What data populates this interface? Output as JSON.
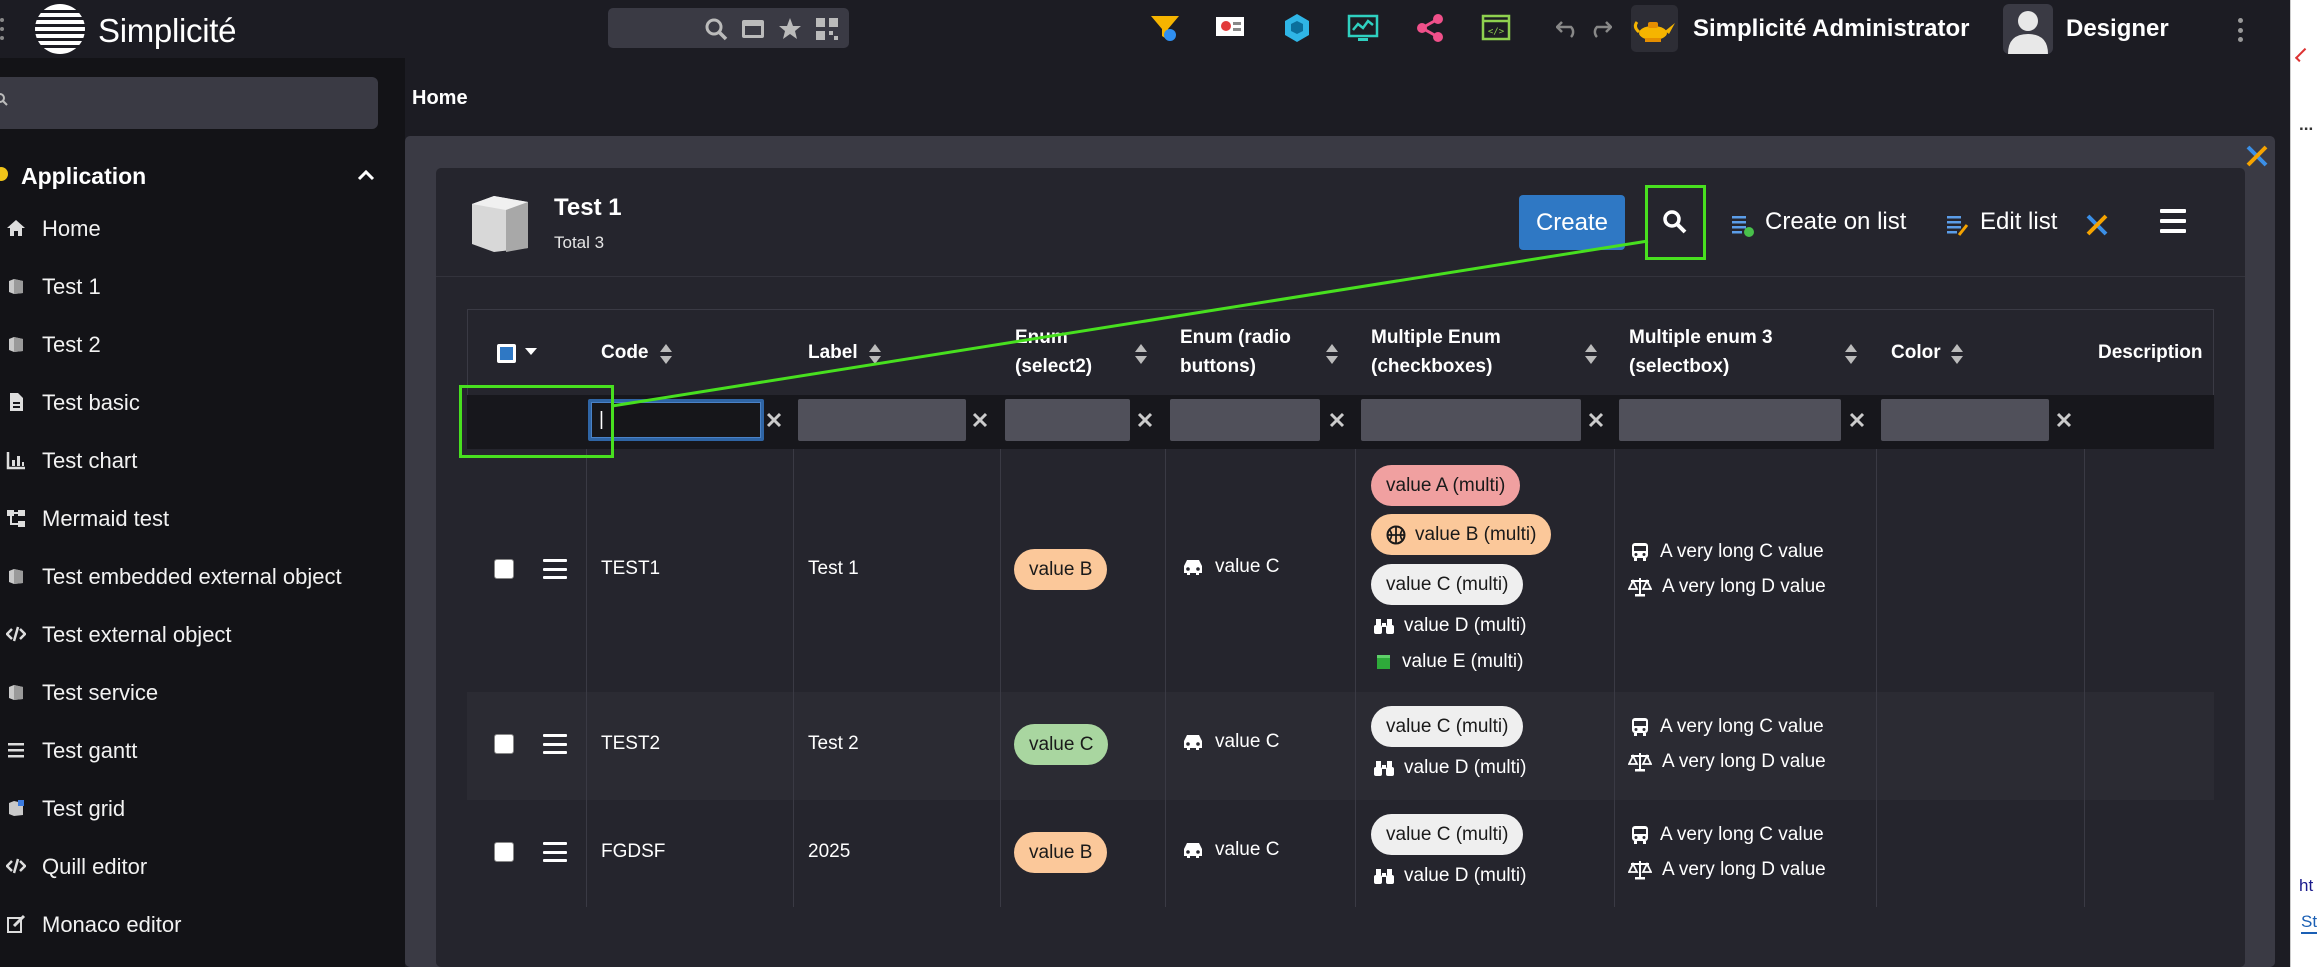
{
  "header": {
    "brand": "Simplicité",
    "user_title": "Simplicité Administrator",
    "role": "Designer"
  },
  "sidebar": {
    "section": "Application",
    "items": [
      {
        "label": "Home",
        "icon": "home-icon"
      },
      {
        "label": "Test 1",
        "icon": "cube-icon"
      },
      {
        "label": "Test 2",
        "icon": "cube-icon"
      },
      {
        "label": "Test basic",
        "icon": "file-icon"
      },
      {
        "label": "Test chart",
        "icon": "chart-icon"
      },
      {
        "label": "Mermaid test",
        "icon": "sitemap-icon"
      },
      {
        "label": "Test embedded external object",
        "icon": "cube-icon"
      },
      {
        "label": "Test external object",
        "icon": "code-icon"
      },
      {
        "label": "Test service",
        "icon": "cube-icon"
      },
      {
        "label": "Test gantt",
        "icon": "list-icon"
      },
      {
        "label": "Test grid",
        "icon": "grid-icon"
      },
      {
        "label": "Quill editor",
        "icon": "code-icon"
      },
      {
        "label": "Monaco editor",
        "icon": "edit-icon"
      }
    ]
  },
  "breadcrumb": "Home",
  "card": {
    "title": "Test 1",
    "total": "Total 3",
    "create_label": "Create",
    "create_on_list": "Create on list",
    "edit_list": "Edit list"
  },
  "table": {
    "columns": {
      "code": "Code",
      "label": "Label",
      "enum1": "Enum",
      "enum2": "(select2)",
      "radio1": "Enum (radio",
      "radio2": "buttons)",
      "multi1": "Multiple Enum",
      "multi2": "(checkboxes)",
      "multi3_1": "Multiple enum 3",
      "multi3_2": "(selectbox)",
      "color": "Color",
      "description": "Description"
    },
    "filter_code_value": "|",
    "rows": [
      {
        "code": "TEST1",
        "label": "Test 1",
        "enum": "value B",
        "radio": "value C",
        "multi": [
          "value A (multi)",
          "value B (multi)",
          "value C (multi)",
          "value D (multi)",
          "value E (multi)"
        ],
        "multi3": [
          "A very long C value",
          "A very long D value"
        ]
      },
      {
        "code": "TEST2",
        "label": "Test 2",
        "enum": "value C",
        "radio": "value C",
        "multi": [
          "value C (multi)",
          "value D (multi)"
        ],
        "multi3": [
          "A very long C value",
          "A very long D value"
        ]
      },
      {
        "code": "FGDSF",
        "label": "2025",
        "enum": "value B",
        "radio": "value C",
        "multi": [
          "value C (multi)",
          "value D (multi)"
        ],
        "multi3": [
          "A very long C value",
          "A very long D value"
        ]
      }
    ]
  },
  "right_strip": {
    "t1": "...",
    "t2": "ht",
    "t3": "St"
  },
  "colors": {
    "accent": "#2f78c4",
    "annotation": "#48e01f",
    "pill_orange": "#fbc89a",
    "pill_red": "#f0a0a0",
    "pill_green": "#a9d6a0",
    "pill_grey": "#efefef"
  }
}
